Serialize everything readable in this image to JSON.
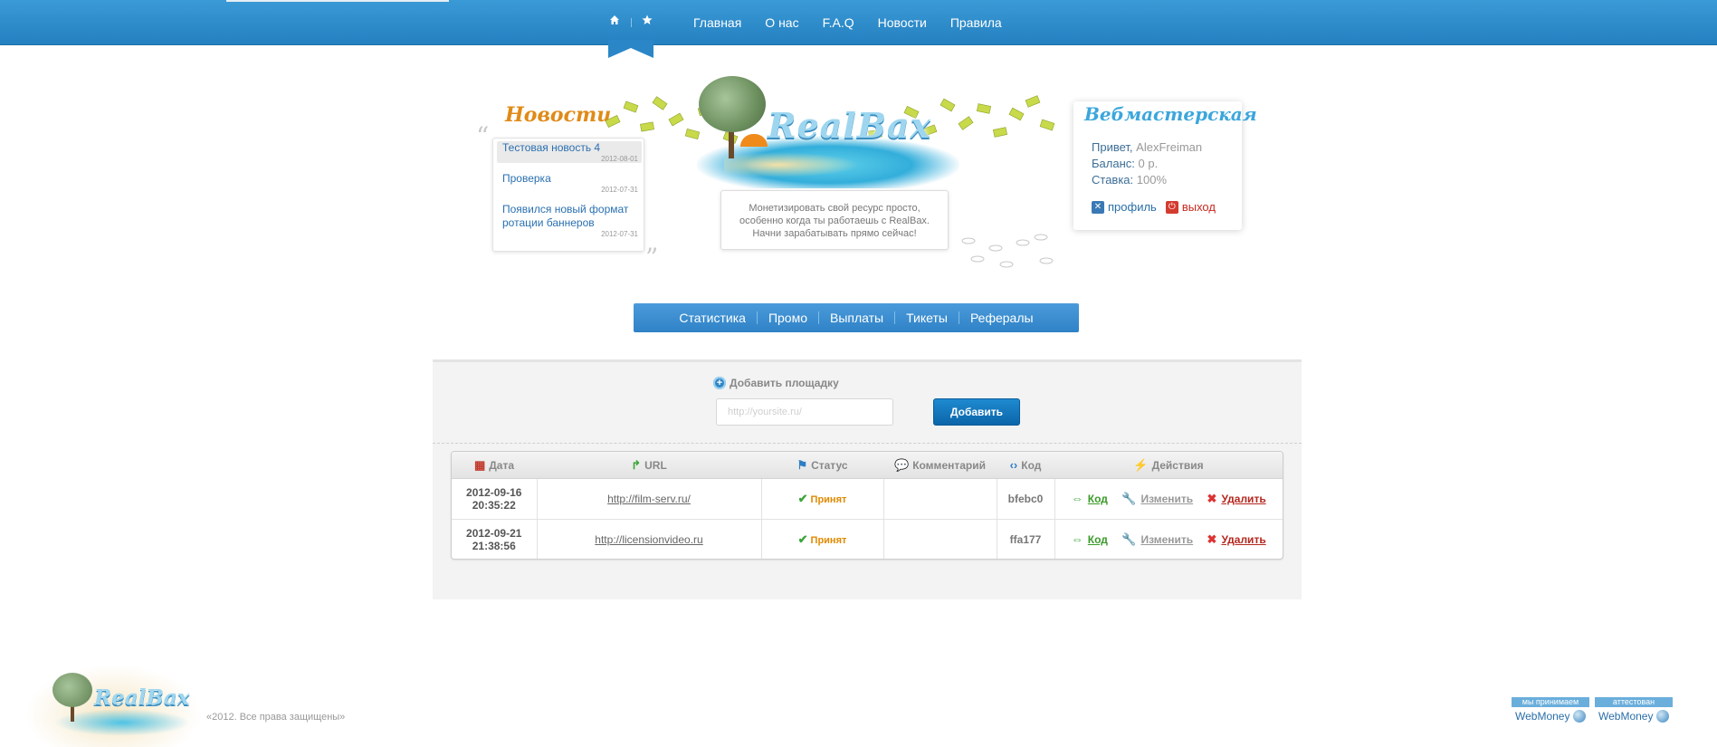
{
  "topnav": {
    "home_icon": "home-icon",
    "star_icon": "star-icon",
    "items": [
      "Главная",
      "О нас",
      "F.A.Q",
      "Новости",
      "Правила"
    ]
  },
  "news": {
    "title": "Новости",
    "items": [
      {
        "title": "Тестовая новость 4",
        "date": "2012-08-01"
      },
      {
        "title": "Проверка",
        "date": "2012-07-31"
      },
      {
        "title": "Появился новый формат ротации баннеров",
        "date": "2012-07-31"
      }
    ]
  },
  "header": {
    "logo": "RealBax",
    "slogan": [
      "Монетизировать свой ресурс просто,",
      "особенно когда ты работаешь с RealBax.",
      "Начни зарабатывать прямо сейчас!"
    ]
  },
  "webmaster": {
    "title": "Вебмастерская",
    "greeting_label": "Привет,",
    "username": "AlexFreiman",
    "balance_label": "Баланс:",
    "balance_value": "0 р.",
    "rate_label": "Ставка:",
    "rate_value": "100%",
    "profile_label": "профиль",
    "logout_label": "выход"
  },
  "subnav": {
    "items": [
      "Статистика",
      "Промо",
      "Выплаты",
      "Тикеты",
      "Рефералы"
    ]
  },
  "add_site": {
    "label": "Добавить площадку",
    "placeholder": "http://yoursite.ru/",
    "button": "Добавить"
  },
  "table": {
    "headers": {
      "date": "Дата",
      "url": "URL",
      "status": "Статус",
      "comment": "Комментарий",
      "code": "Код",
      "actions": "Действия"
    },
    "action_labels": {
      "code": "Код",
      "edit": "Изменить",
      "delete": "Удалить"
    },
    "rows": [
      {
        "date": "2012-09-16",
        "time": "20:35:22",
        "url": "http://film-serv.ru/",
        "status": "Принят",
        "comment": "",
        "code": "bfebc0"
      },
      {
        "date": "2012-09-21",
        "time": "21:38:56",
        "url": "http://licensionvideo.ru",
        "status": "Принят",
        "comment": "",
        "code": "ffa177"
      }
    ]
  },
  "footer": {
    "logo": "RealBax",
    "copyright": "«2012. Все права защищены»",
    "badge_accept_top": "мы принимаем",
    "badge_accept_bottom": "WebMoney",
    "badge_attest_top": "аттестован",
    "badge_attest_bottom": "WebMoney"
  },
  "colors": {
    "nav_blue": "#2580c0",
    "accent_orange": "#e08a17",
    "status_accepted": "#e08a00",
    "delete_red": "#b4281f",
    "code_green": "#3b9a2a"
  }
}
